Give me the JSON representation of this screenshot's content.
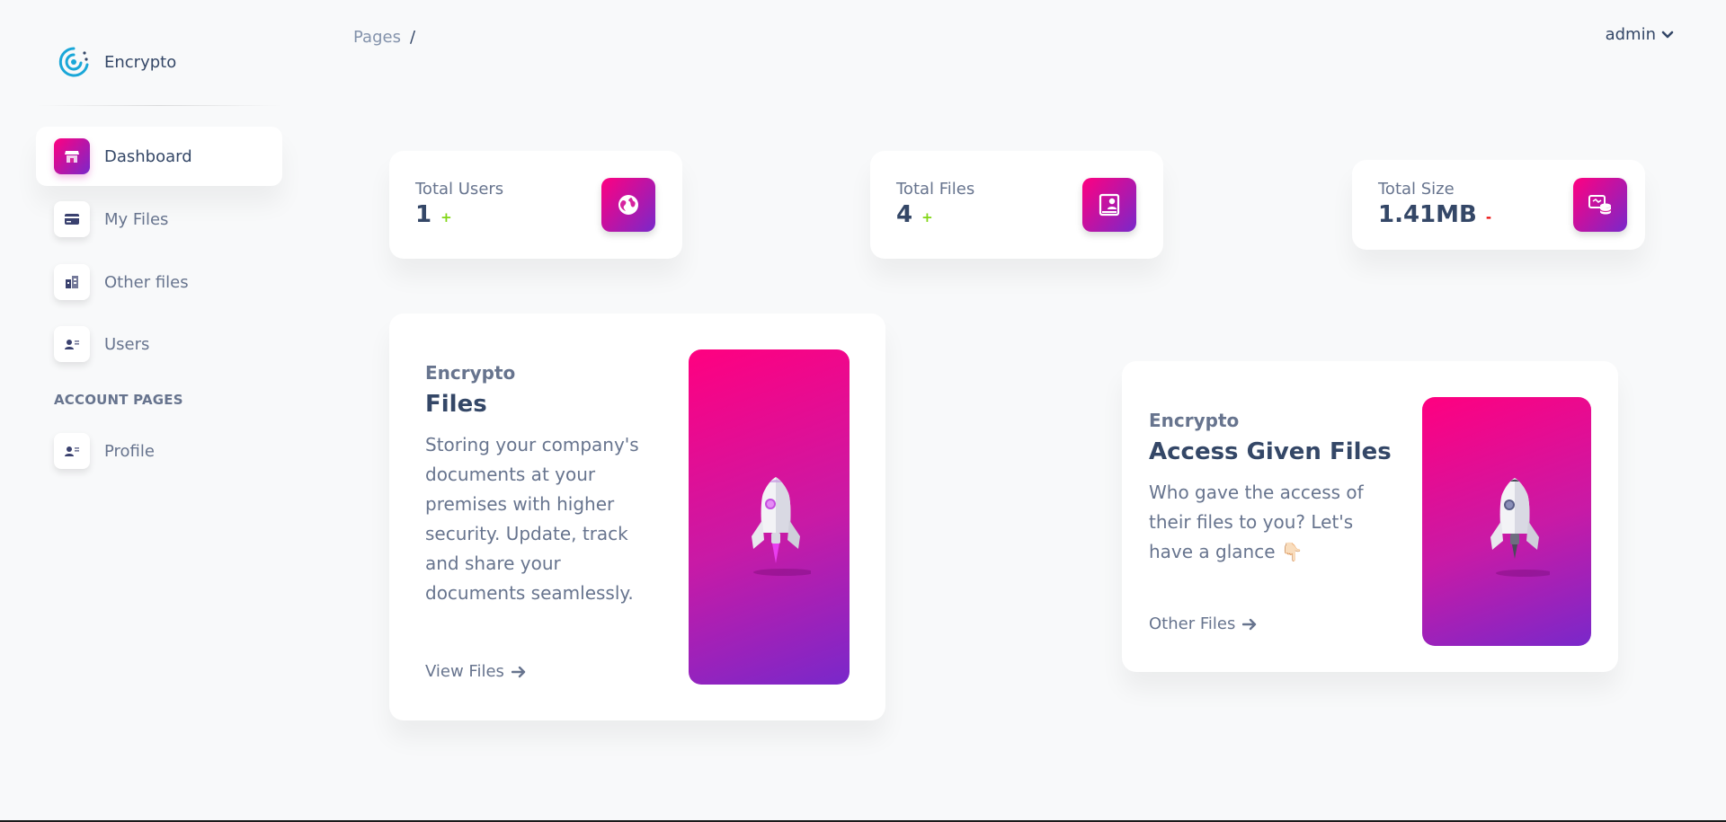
{
  "brand": {
    "name": "Encrypto"
  },
  "sidebar": {
    "items": [
      {
        "label": "Dashboard",
        "icon": "shop-icon",
        "active": true
      },
      {
        "label": "My Files",
        "icon": "credit-card-icon",
        "active": false
      },
      {
        "label": "Other files",
        "icon": "office-icon",
        "active": false
      },
      {
        "label": "Users",
        "icon": "user-card-icon",
        "active": false
      }
    ],
    "section_heading": "ACCOUNT PAGES",
    "account_items": [
      {
        "label": "Profile",
        "icon": "user-card-icon"
      }
    ]
  },
  "header": {
    "breadcrumb_root": "Pages",
    "breadcrumb_separator": "/",
    "user": "admin",
    "user_icon": "chevron-down-icon"
  },
  "stats": [
    {
      "title": "Total Users",
      "value": "1",
      "change": "+",
      "change_color": "#82d616",
      "icon": "globe-icon"
    },
    {
      "title": "Total Files",
      "value": "4",
      "change": "+",
      "change_color": "#82d616",
      "icon": "file-user-icon"
    },
    {
      "title": "Total Size",
      "value": "1.41MB",
      "change": "-",
      "change_color": "#ea0606",
      "icon": "database-icon"
    }
  ],
  "cards": [
    {
      "eyebrow": "Encrypto",
      "title": "Files",
      "description_lines": [
        "Storing your company's",
        "documents at your",
        "premises with higher",
        "security. Update, track",
        "and share your",
        "documents seamlessly."
      ],
      "link": "View Files",
      "link_icon": "arrow-right-icon",
      "image": "rocket-illustration"
    },
    {
      "eyebrow": "Encrypto",
      "title": "Access Given Files",
      "description_lines": [
        "Who gave the access of",
        "their files to you? Let's",
        "have a glance 👇🏻"
      ],
      "link": "Other Files",
      "link_icon": "arrow-right-icon",
      "image": "rocket-illustration"
    }
  ],
  "colors": {
    "accent_gradient_start": "#ff0080",
    "accent_gradient_end": "#7928ca",
    "text_primary": "#344767",
    "text_secondary": "#67748e",
    "background": "#f8f9fa"
  }
}
